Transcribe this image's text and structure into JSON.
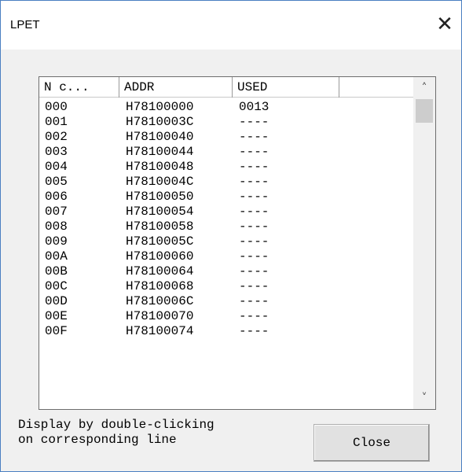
{
  "window": {
    "title": "LPET",
    "close_glyph": "✕"
  },
  "list": {
    "columns": [
      "N c...",
      "ADDR",
      "USED",
      ""
    ],
    "rows": [
      {
        "n": "000",
        "addr": "H78100000",
        "used": "0013"
      },
      {
        "n": "001",
        "addr": "H7810003C",
        "used": "----"
      },
      {
        "n": "002",
        "addr": "H78100040",
        "used": "----"
      },
      {
        "n": "003",
        "addr": "H78100044",
        "used": "----"
      },
      {
        "n": "004",
        "addr": "H78100048",
        "used": "----"
      },
      {
        "n": "005",
        "addr": "H7810004C",
        "used": "----"
      },
      {
        "n": "006",
        "addr": "H78100050",
        "used": "----"
      },
      {
        "n": "007",
        "addr": "H78100054",
        "used": "----"
      },
      {
        "n": "008",
        "addr": "H78100058",
        "used": "----"
      },
      {
        "n": "009",
        "addr": "H7810005C",
        "used": "----"
      },
      {
        "n": "00A",
        "addr": "H78100060",
        "used": "----"
      },
      {
        "n": "00B",
        "addr": "H78100064",
        "used": "----"
      },
      {
        "n": "00C",
        "addr": "H78100068",
        "used": "----"
      },
      {
        "n": "00D",
        "addr": "H7810006C",
        "used": "----"
      },
      {
        "n": "00E",
        "addr": "H78100070",
        "used": "----"
      },
      {
        "n": "00F",
        "addr": "H78100074",
        "used": "----"
      }
    ],
    "scroll_up_glyph": "˄",
    "scroll_down_glyph": "˅"
  },
  "footer": {
    "hint_line1": "Display by double-clicking",
    "hint_line2": "on corresponding line",
    "close_label": "Close"
  }
}
